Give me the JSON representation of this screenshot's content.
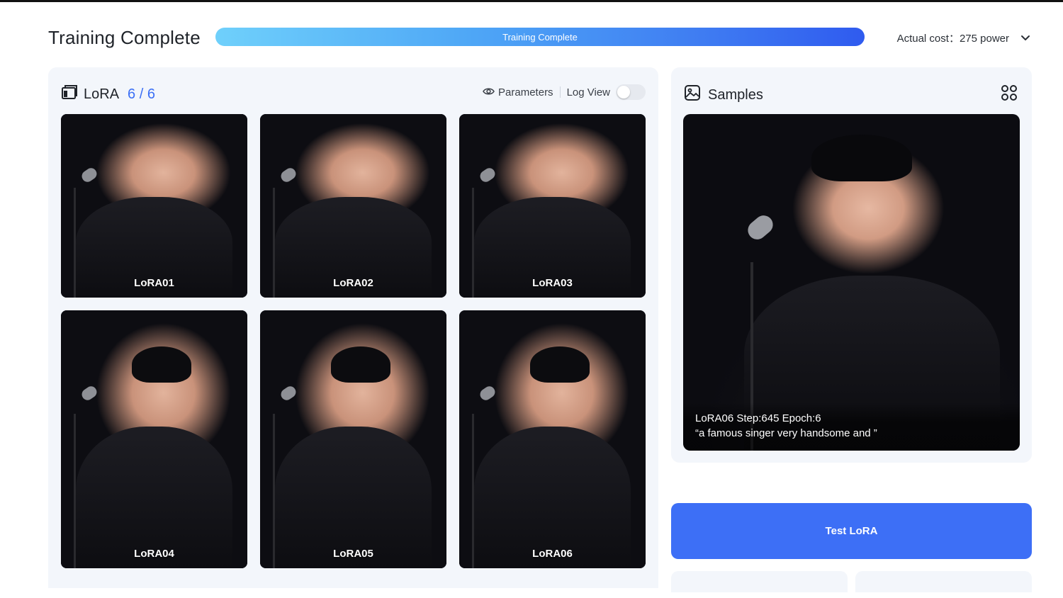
{
  "header": {
    "title": "Training Complete",
    "progress_label": "Training Complete",
    "progress_value": 1.0,
    "cost_label": "Actual cost：275 power"
  },
  "lora_panel": {
    "title": "LoRA",
    "count": "6 / 6",
    "parameters_label": "Parameters",
    "log_view_label": "Log View",
    "log_view_enabled": false,
    "items": [
      {
        "label": "LoRA01"
      },
      {
        "label": "LoRA02"
      },
      {
        "label": "LoRA03"
      },
      {
        "label": "LoRA04"
      },
      {
        "label": "LoRA05"
      },
      {
        "label": "LoRA06"
      }
    ]
  },
  "samples_panel": {
    "title": "Samples",
    "caption_line1": "LoRA06 Step:645 Epoch:6",
    "caption_line2": "“a famous singer very handsome and ”"
  },
  "actions": {
    "test_button": "Test LoRA"
  },
  "colors": {
    "accent": "#3d6ff6",
    "count_blue": "#3b6ff5",
    "panel_bg": "#f3f6fb"
  }
}
